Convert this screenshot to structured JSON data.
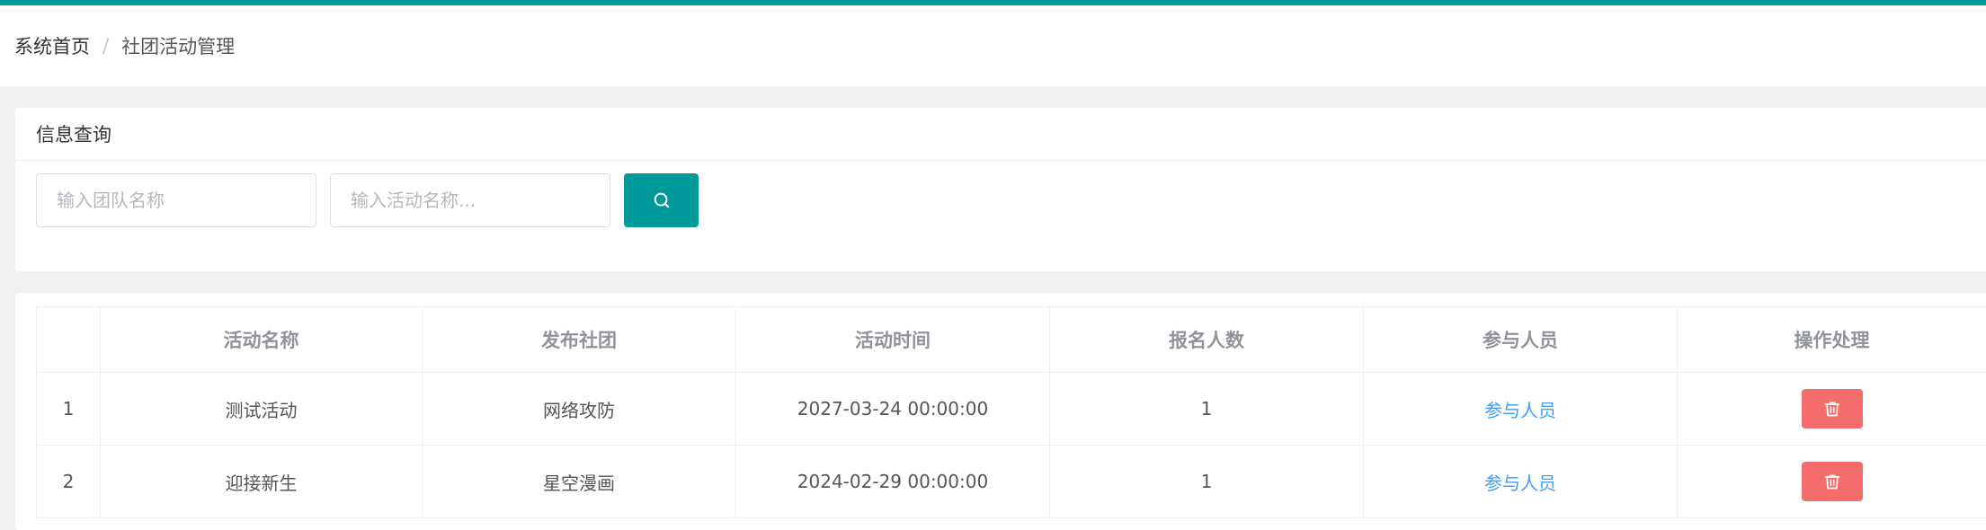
{
  "breadcrumb": {
    "home": "系统首页",
    "separator": "/",
    "current": "社团活动管理"
  },
  "search": {
    "title": "信息查询",
    "team_placeholder": "输入团队名称",
    "activity_placeholder": "输入活动名称..."
  },
  "table": {
    "headers": [
      "",
      "活动名称",
      "发布社团",
      "活动时间",
      "报名人数",
      "参与人员",
      "操作处理"
    ],
    "rows": [
      {
        "index": "1",
        "name": "测试活动",
        "club": "网络攻防",
        "time": "2027-03-24 00:00:00",
        "count": "1",
        "participants": "参与人员"
      },
      {
        "index": "2",
        "name": "迎接新生",
        "club": "星空漫画",
        "time": "2024-02-29 00:00:00",
        "count": "1",
        "participants": "参与人员"
      }
    ]
  },
  "colors": {
    "accent": "#009999",
    "link": "#409eff",
    "danger": "#f56c6c"
  },
  "icons": {
    "search": "search-icon",
    "delete": "trash-icon"
  }
}
